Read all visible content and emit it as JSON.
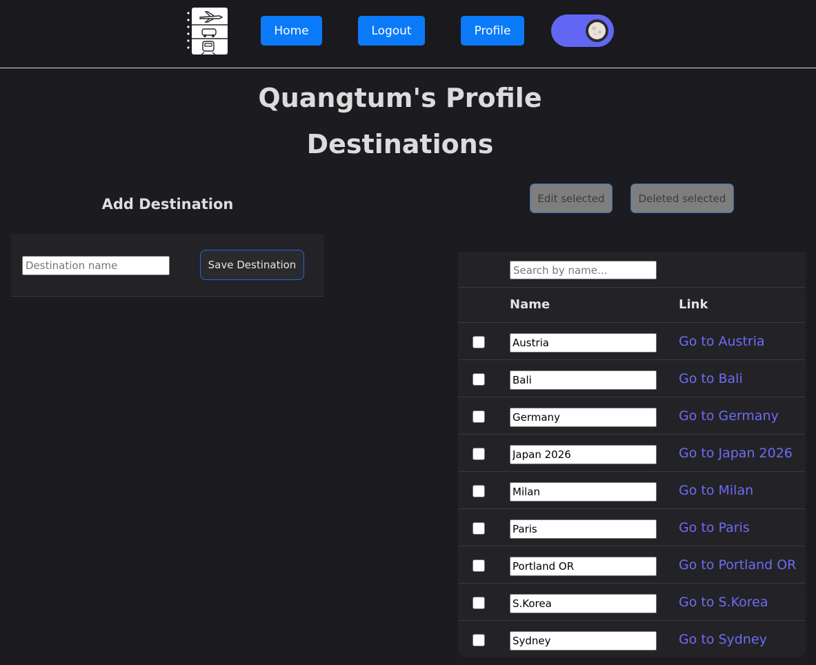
{
  "nav": {
    "home_label": "Home",
    "logout_label": "Logout",
    "profile_label": "Profile"
  },
  "page": {
    "title": "Quangtum's Profile",
    "subtitle": "Destinations"
  },
  "add_destination": {
    "heading": "Add Destination",
    "placeholder": "Destination name",
    "save_label": "Save Destination"
  },
  "actions": {
    "edit_label": "Edit selected",
    "delete_label": "Deleted selected"
  },
  "table": {
    "search_placeholder": "Search by name...",
    "columns": {
      "name": "Name",
      "link": "Link"
    },
    "rows": [
      {
        "name": "Austria",
        "link": "Go to Austria"
      },
      {
        "name": "Bali",
        "link": "Go to Bali"
      },
      {
        "name": "Germany",
        "link": "Go to Germany"
      },
      {
        "name": "Japan 2026",
        "link": "Go to Japan 2026"
      },
      {
        "name": "Milan",
        "link": "Go to Milan"
      },
      {
        "name": "Paris",
        "link": "Go to Paris"
      },
      {
        "name": "Portland OR",
        "link": "Go to Portland OR"
      },
      {
        "name": "S.Korea",
        "link": "Go to S.Korea"
      },
      {
        "name": "Sydney",
        "link": "Go to Sydney"
      }
    ]
  },
  "colors": {
    "accent": "#0b7af9",
    "link": "#6e6cf2",
    "toggle": "#6167f3",
    "background": "#1c1b20"
  },
  "icons": {
    "logo": "travel-logo-icon",
    "theme_toggle": "moon-icon"
  }
}
